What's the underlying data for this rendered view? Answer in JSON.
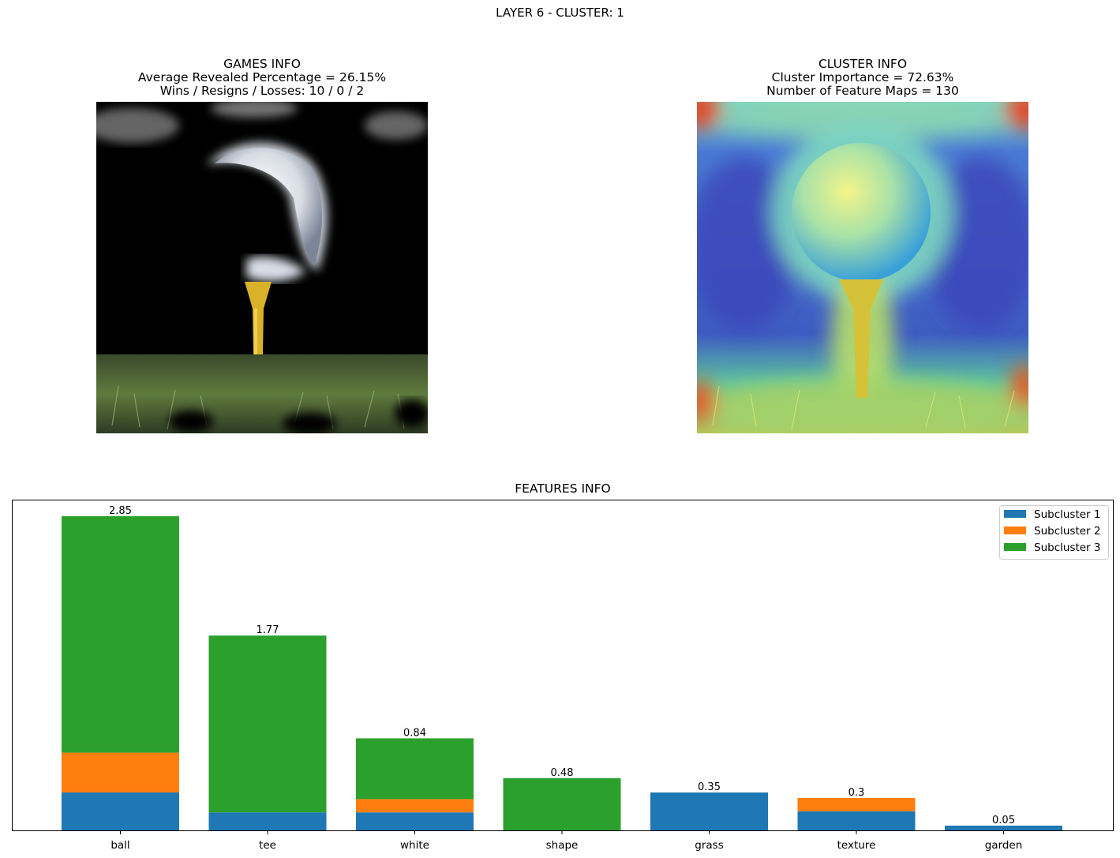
{
  "figure": {
    "title": "LAYER 6 - CLUSTER: 1"
  },
  "games_panel": {
    "title": "GAMES INFO",
    "line1": "Average Revealed Percentage = 26.15%",
    "line2": "Wins / Resigns / Losses: 10 / 0 / 2"
  },
  "cluster_panel": {
    "title": "CLUSTER INFO",
    "line1": "Cluster Importance = 72.63%",
    "line2": "Number of Feature Maps = 130"
  },
  "chart_data": {
    "type": "bar",
    "stacked": true,
    "title": "FEATURES INFO",
    "xlabel": "",
    "ylabel": "",
    "ylim": [
      0,
      3.0
    ],
    "grid": false,
    "legend_position": "top-right",
    "categories": [
      "ball",
      "tee",
      "white",
      "shape",
      "grass",
      "texture",
      "garden"
    ],
    "totals_labels": [
      "2.85",
      "1.77",
      "0.84",
      "0.48",
      "0.35",
      "0.3",
      "0.05"
    ],
    "series": [
      {
        "name": "Subcluster 1",
        "color": "#1f77b4",
        "values": [
          0.35,
          0.17,
          0.17,
          0.0,
          0.35,
          0.18,
          0.05
        ]
      },
      {
        "name": "Subcluster 2",
        "color": "#ff7f0e",
        "values": [
          0.36,
          0.0,
          0.12,
          0.0,
          0.0,
          0.12,
          0.0
        ]
      },
      {
        "name": "Subcluster 3",
        "color": "#2ca02c",
        "values": [
          2.14,
          1.6,
          0.55,
          0.48,
          0.0,
          0.0,
          0.0
        ]
      }
    ]
  }
}
